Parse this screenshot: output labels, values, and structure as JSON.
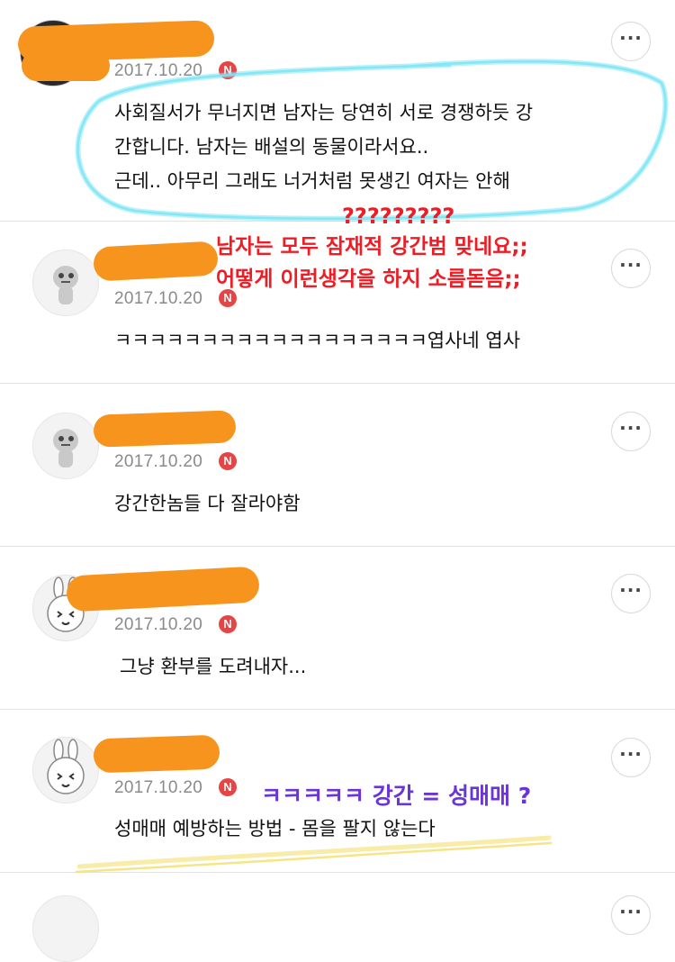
{
  "comments": [
    {
      "date": "2017.10.20",
      "badge": "N",
      "more": "···",
      "lines": [
        "사회질서가 무너지면 남자는 당연히 서로 경쟁하듯 강",
        "간합니다. 남자는 배설의 동물이라서요..",
        "근데.. 아무리 그래도 너거처럼 못생긴 여자는 안해"
      ]
    },
    {
      "date": "2017.10.20",
      "badge": "N",
      "more": "···",
      "text": "ㅋㅋㅋㅋㅋㅋㅋㅋㅋㅋㅋㅋㅋㅋㅋㅋㅋㅋ엽사네 엽사"
    },
    {
      "date": "2017.10.20",
      "badge": "N",
      "more": "···",
      "text": "강간한놈들 다 잘라야함"
    },
    {
      "date": "2017.10.20",
      "badge": "N",
      "more": "···",
      "text": "그냥 환부를 도려내자..."
    },
    {
      "date": "2017.10.20",
      "badge": "N",
      "more": "···",
      "text": "성매매 예방하는 방법 - 몸을 팔지 않는다"
    }
  ],
  "annotations": {
    "question_marks": "?????????",
    "red_line1": "남자는 모두 잠재적 강간범 맞네요;;",
    "red_line2": "어떻게 이런생각을 하지 소름돋음;;",
    "purple": "ㅋㅋㅋㅋㅋ 강간 = 성매매 ?"
  },
  "colors": {
    "red_annotation": "#ee1c25",
    "purple_annotation": "#6b34d6",
    "redaction": "#f7941d",
    "highlight_cyan": "#7fe6f5",
    "highlight_yellow": "#f5e27a",
    "badge": "#e64545"
  }
}
